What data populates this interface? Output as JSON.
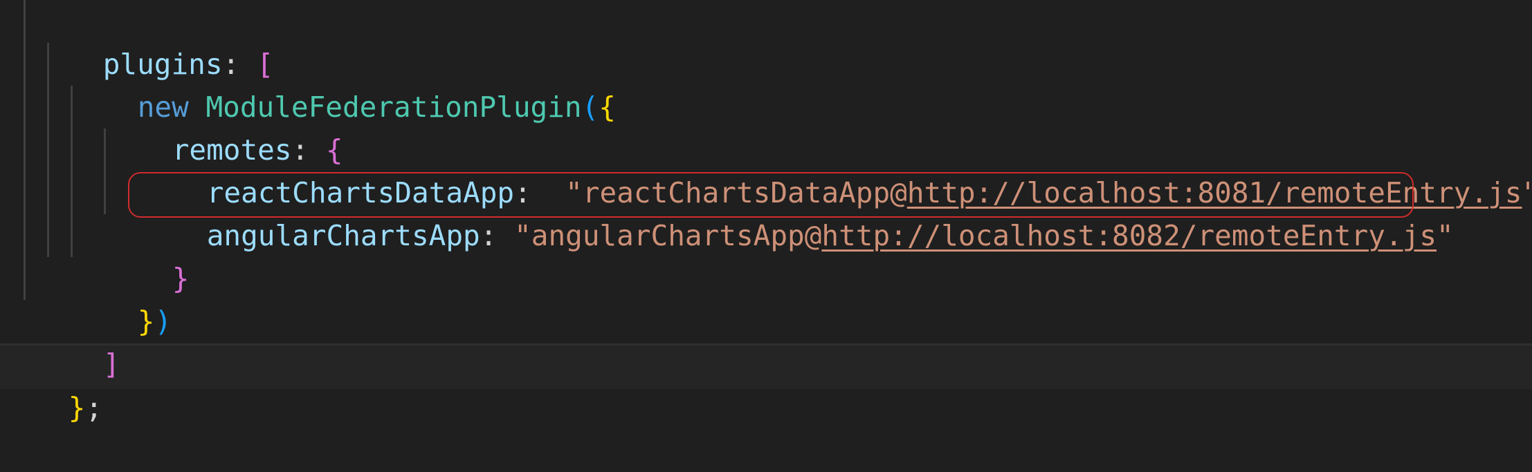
{
  "code": {
    "line1": {
      "prop": "plugins",
      "colon": ": ",
      "bracket": "["
    },
    "line2": {
      "keyword": "new",
      "space": " ",
      "class_name": "ModuleFederationPlugin",
      "paren": "(",
      "brace": "{"
    },
    "line3": {
      "prop": "remotes",
      "colon": ": ",
      "brace": "{"
    },
    "line4": {
      "prop": "reactChartsDataApp",
      "colon": ":  ",
      "quote_open": "\"",
      "str_prefix": "reactChartsDataApp@",
      "url": "http://localhost:8081/remoteEntry.js",
      "quote_close": "\"",
      "comma": ","
    },
    "line5": {
      "prop": "angularChartsApp",
      "colon": ": ",
      "quote_open": "\"",
      "str_prefix": "angularChartsApp@",
      "url": "http://localhost:8082/remoteEntry.js",
      "quote_close": "\""
    },
    "line6": {
      "brace": "}"
    },
    "line7": {
      "brace": "}",
      "paren": ")"
    },
    "line8": {
      "bracket": "]"
    },
    "line9": {
      "brace": "}",
      "semicolon": ";"
    }
  },
  "colors": {
    "background": "#1f1f1f",
    "property": "#9cdcfe",
    "keyword": "#569cd6",
    "class": "#4ec9b0",
    "string": "#ce9178",
    "bracket_gold": "#ffd700",
    "bracket_pink": "#da70d6",
    "bracket_blue": "#179fff",
    "highlight_border": "#d12b2b"
  }
}
